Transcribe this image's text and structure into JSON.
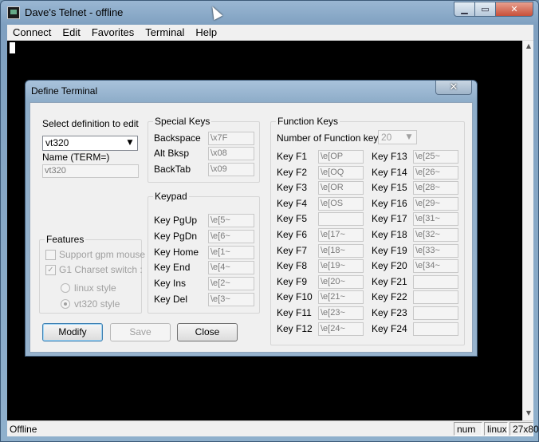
{
  "window": {
    "title": "Dave's Telnet - offline"
  },
  "menu": [
    "Connect",
    "Edit",
    "Favorites",
    "Terminal",
    "Help"
  ],
  "status": {
    "text": "Offline",
    "num": "num",
    "term": "linux",
    "size": "27x80"
  },
  "dialog": {
    "title": "Define Terminal",
    "close_label": "✕",
    "select_def_label": "Select definition to edit",
    "definition": "vt320",
    "name_label": "Name (TERM=)",
    "name_value": "vt320",
    "special_keys": {
      "label": "Special Keys",
      "rows": [
        {
          "label": "Backspace",
          "value": "\\x7F"
        },
        {
          "label": "Alt Bksp",
          "value": "\\x08"
        },
        {
          "label": "BackTab",
          "value": "\\x09"
        }
      ]
    },
    "keypad": {
      "label": "Keypad",
      "rows": [
        {
          "label": "Key PgUp",
          "value": "\\e[5~"
        },
        {
          "label": "Key PgDn",
          "value": "\\e[6~"
        },
        {
          "label": "Key Home",
          "value": "\\e[1~"
        },
        {
          "label": "Key End",
          "value": "\\e[4~"
        },
        {
          "label": "Key Ins",
          "value": "\\e[2~"
        },
        {
          "label": "Key Del",
          "value": "\\e[3~"
        }
      ]
    },
    "features": {
      "label": "Features",
      "gpm_label": "Support gpm mouse",
      "g1_label": "G1 Charset switch :",
      "linux_label": "linux style",
      "vt320_label": "vt320 style",
      "gpm_checked": false,
      "g1_checked": true,
      "style_selected": "vt320"
    },
    "function_keys": {
      "label": "Function Keys",
      "count_label": "Number of Function keys",
      "count": "20",
      "left": [
        {
          "label": "Key F1",
          "value": "\\e[OP"
        },
        {
          "label": "Key F2",
          "value": "\\e[OQ"
        },
        {
          "label": "Key F3",
          "value": "\\e[OR"
        },
        {
          "label": "Key F4",
          "value": "\\e[OS"
        },
        {
          "label": "Key F5",
          "value": ""
        },
        {
          "label": "Key F6",
          "value": "\\e[17~"
        },
        {
          "label": "Key F7",
          "value": "\\e[18~"
        },
        {
          "label": "Key F8",
          "value": "\\e[19~"
        },
        {
          "label": "Key F9",
          "value": "\\e[20~"
        },
        {
          "label": "Key F10",
          "value": "\\e[21~"
        },
        {
          "label": "Key F11",
          "value": "\\e[23~"
        },
        {
          "label": "Key F12",
          "value": "\\e[24~"
        }
      ],
      "right": [
        {
          "label": "Key F13",
          "value": "\\e[25~"
        },
        {
          "label": "Key F14",
          "value": "\\e[26~"
        },
        {
          "label": "Key F15",
          "value": "\\e[28~"
        },
        {
          "label": "Key F16",
          "value": "\\e[29~"
        },
        {
          "label": "Key F17",
          "value": "\\e[31~"
        },
        {
          "label": "Key F18",
          "value": "\\e[32~"
        },
        {
          "label": "Key F19",
          "value": "\\e[33~"
        },
        {
          "label": "Key F20",
          "value": "\\e[34~"
        },
        {
          "label": "Key F21",
          "value": ""
        },
        {
          "label": "Key F22",
          "value": ""
        },
        {
          "label": "Key F23",
          "value": ""
        },
        {
          "label": "Key F24",
          "value": ""
        }
      ]
    },
    "buttons": {
      "modify": "Modify",
      "save": "Save",
      "close": "Close"
    }
  }
}
